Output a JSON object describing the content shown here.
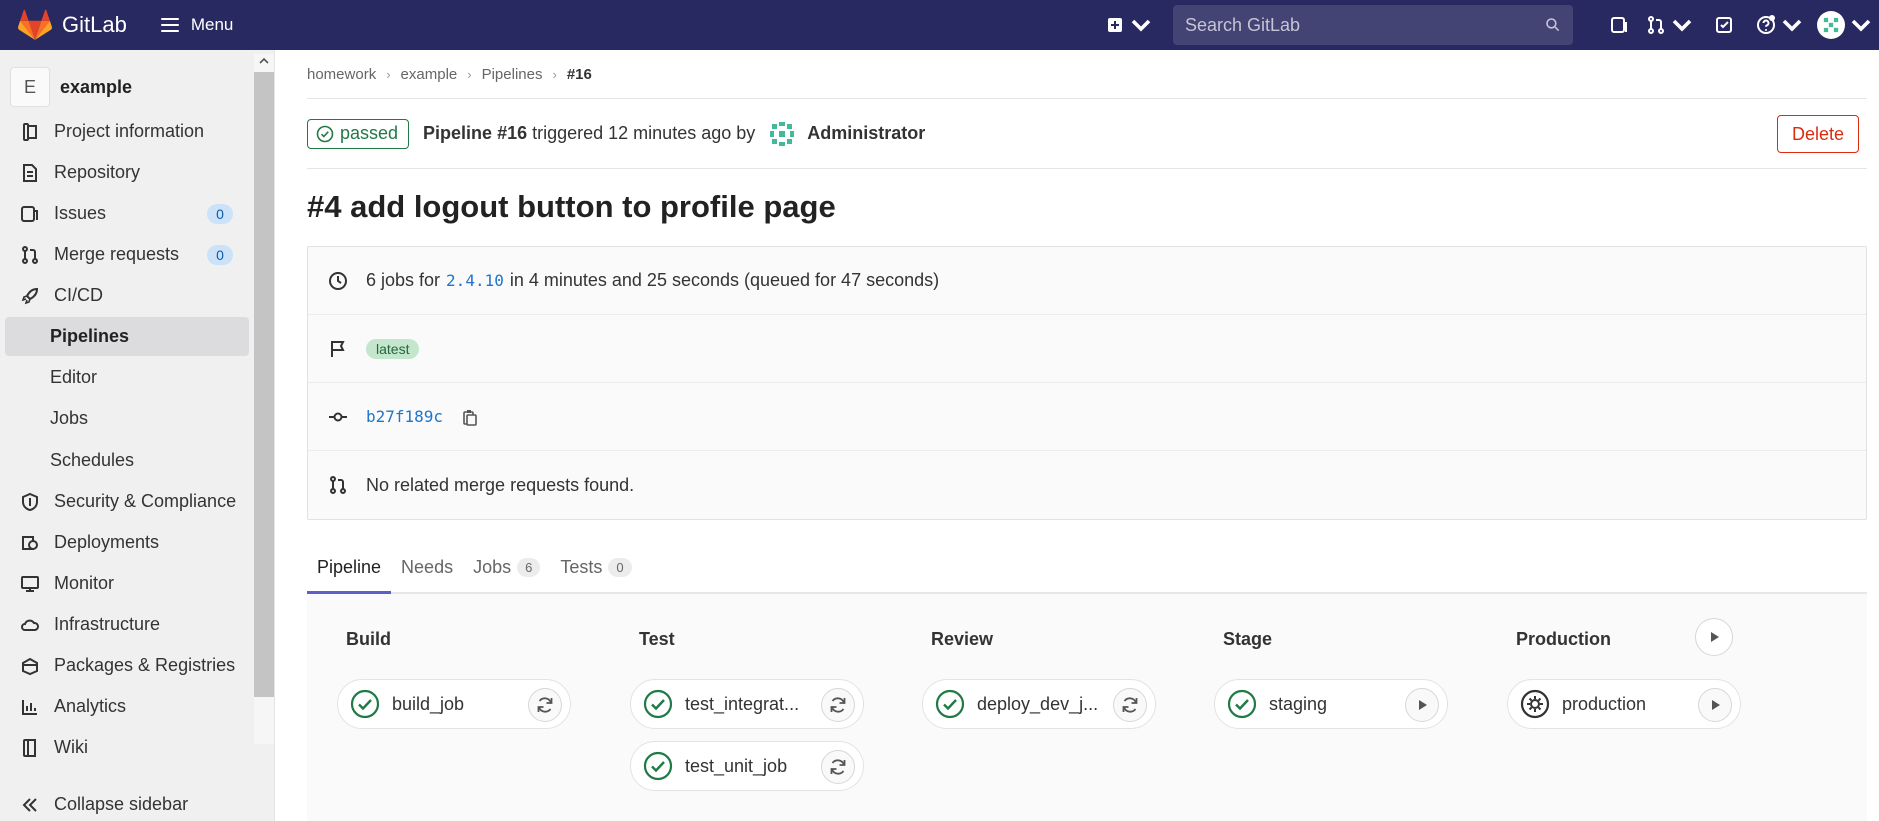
{
  "nav": {
    "brand": "GitLab",
    "menu_label": "Menu",
    "search_placeholder": "Search GitLab"
  },
  "sidebar": {
    "project_initial": "E",
    "project_name": "example",
    "items": [
      {
        "label": "Project information",
        "icon": "info-icon"
      },
      {
        "label": "Repository",
        "icon": "document-icon"
      },
      {
        "label": "Issues",
        "icon": "issues-icon",
        "count": "0"
      },
      {
        "label": "Merge requests",
        "icon": "merge-request-icon",
        "count": "0"
      },
      {
        "label": "CI/CD",
        "icon": "rocket-icon"
      },
      {
        "label": "Pipelines",
        "active": true
      },
      {
        "label": "Editor"
      },
      {
        "label": "Jobs"
      },
      {
        "label": "Schedules"
      },
      {
        "label": "Security & Compliance",
        "icon": "shield-icon"
      },
      {
        "label": "Deployments",
        "icon": "deployments-icon"
      },
      {
        "label": "Monitor",
        "icon": "monitor-icon"
      },
      {
        "label": "Infrastructure",
        "icon": "cloud-icon"
      },
      {
        "label": "Packages & Registries",
        "icon": "package-icon"
      },
      {
        "label": "Analytics",
        "icon": "chart-icon"
      },
      {
        "label": "Wiki",
        "icon": "book-icon"
      }
    ],
    "collapse_label": "Collapse sidebar"
  },
  "breadcrumb": [
    "homework",
    "example",
    "Pipelines",
    "#16"
  ],
  "pipeline": {
    "status": "passed",
    "title": "Pipeline #16",
    "triggered": "triggered 12 minutes ago by",
    "user": "Administrator",
    "delete_label": "Delete",
    "commit_title": "#4 add logout button to profile page",
    "jobs_prefix": "6 jobs for",
    "ref": "2.4.10",
    "duration_text": "in 4 minutes and 25 seconds (queued for 47 seconds)",
    "tag": "latest",
    "commit_sha": "b27f189c",
    "mr_text": "No related merge requests found."
  },
  "tabs": [
    {
      "label": "Pipeline",
      "active": true
    },
    {
      "label": "Needs"
    },
    {
      "label": "Jobs",
      "count": "6"
    },
    {
      "label": "Tests",
      "count": "0"
    }
  ],
  "stages": [
    {
      "name": "Build",
      "jobs": [
        {
          "name": "build_job",
          "status": "passed",
          "action": "retry"
        }
      ]
    },
    {
      "name": "Test",
      "jobs": [
        {
          "name": "test_integrat...",
          "status": "passed",
          "action": "retry"
        },
        {
          "name": "test_unit_job",
          "status": "passed",
          "action": "retry"
        }
      ]
    },
    {
      "name": "Review",
      "jobs": [
        {
          "name": "deploy_dev_j...",
          "status": "passed",
          "action": "retry"
        }
      ]
    },
    {
      "name": "Stage",
      "jobs": [
        {
          "name": "staging",
          "status": "passed",
          "action": "play"
        }
      ]
    },
    {
      "name": "Production",
      "jobs": [
        {
          "name": "production",
          "status": "manual",
          "action": "play"
        }
      ]
    }
  ],
  "colors": {
    "nav_bg": "#292961",
    "success": "#1f7a45",
    "danger": "#dd2b0e",
    "link": "#1f75cb",
    "tab_active": "#5b5fc7"
  }
}
